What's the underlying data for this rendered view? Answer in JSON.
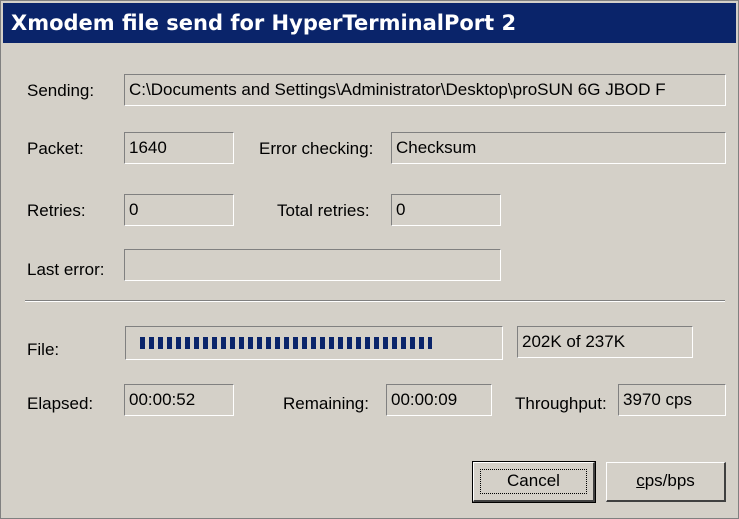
{
  "window": {
    "title": "Xmodem file send for HyperTerminalPort 2"
  },
  "sending": {
    "label": "Sending:",
    "value": "C:\\Documents and Settings\\Administrator\\Desktop\\proSUN 6G JBOD F"
  },
  "packet": {
    "label": "Packet:",
    "value": "1640"
  },
  "error_checking": {
    "label": "Error checking:",
    "value": "Checksum"
  },
  "retries": {
    "label": "Retries:",
    "value": "0"
  },
  "total_retries": {
    "label": "Total retries:",
    "value": "0"
  },
  "last_error": {
    "label": "Last error:",
    "value": ""
  },
  "file": {
    "label": "File:",
    "progress_fraction": 0.85,
    "progress_text": "202K of 237K"
  },
  "elapsed": {
    "label": "Elapsed:",
    "value": "00:00:52"
  },
  "remaining": {
    "label": "Remaining:",
    "value": "00:00:09"
  },
  "throughput": {
    "label": "Throughput:",
    "value": "3970 cps"
  },
  "buttons": {
    "cancel": "Cancel",
    "cps_bps_accel": "c",
    "cps_bps_rest": "ps/bps"
  },
  "colors": {
    "titlebar": "#0a246a",
    "face": "#d4d0c8",
    "progress": "#0a246a"
  }
}
